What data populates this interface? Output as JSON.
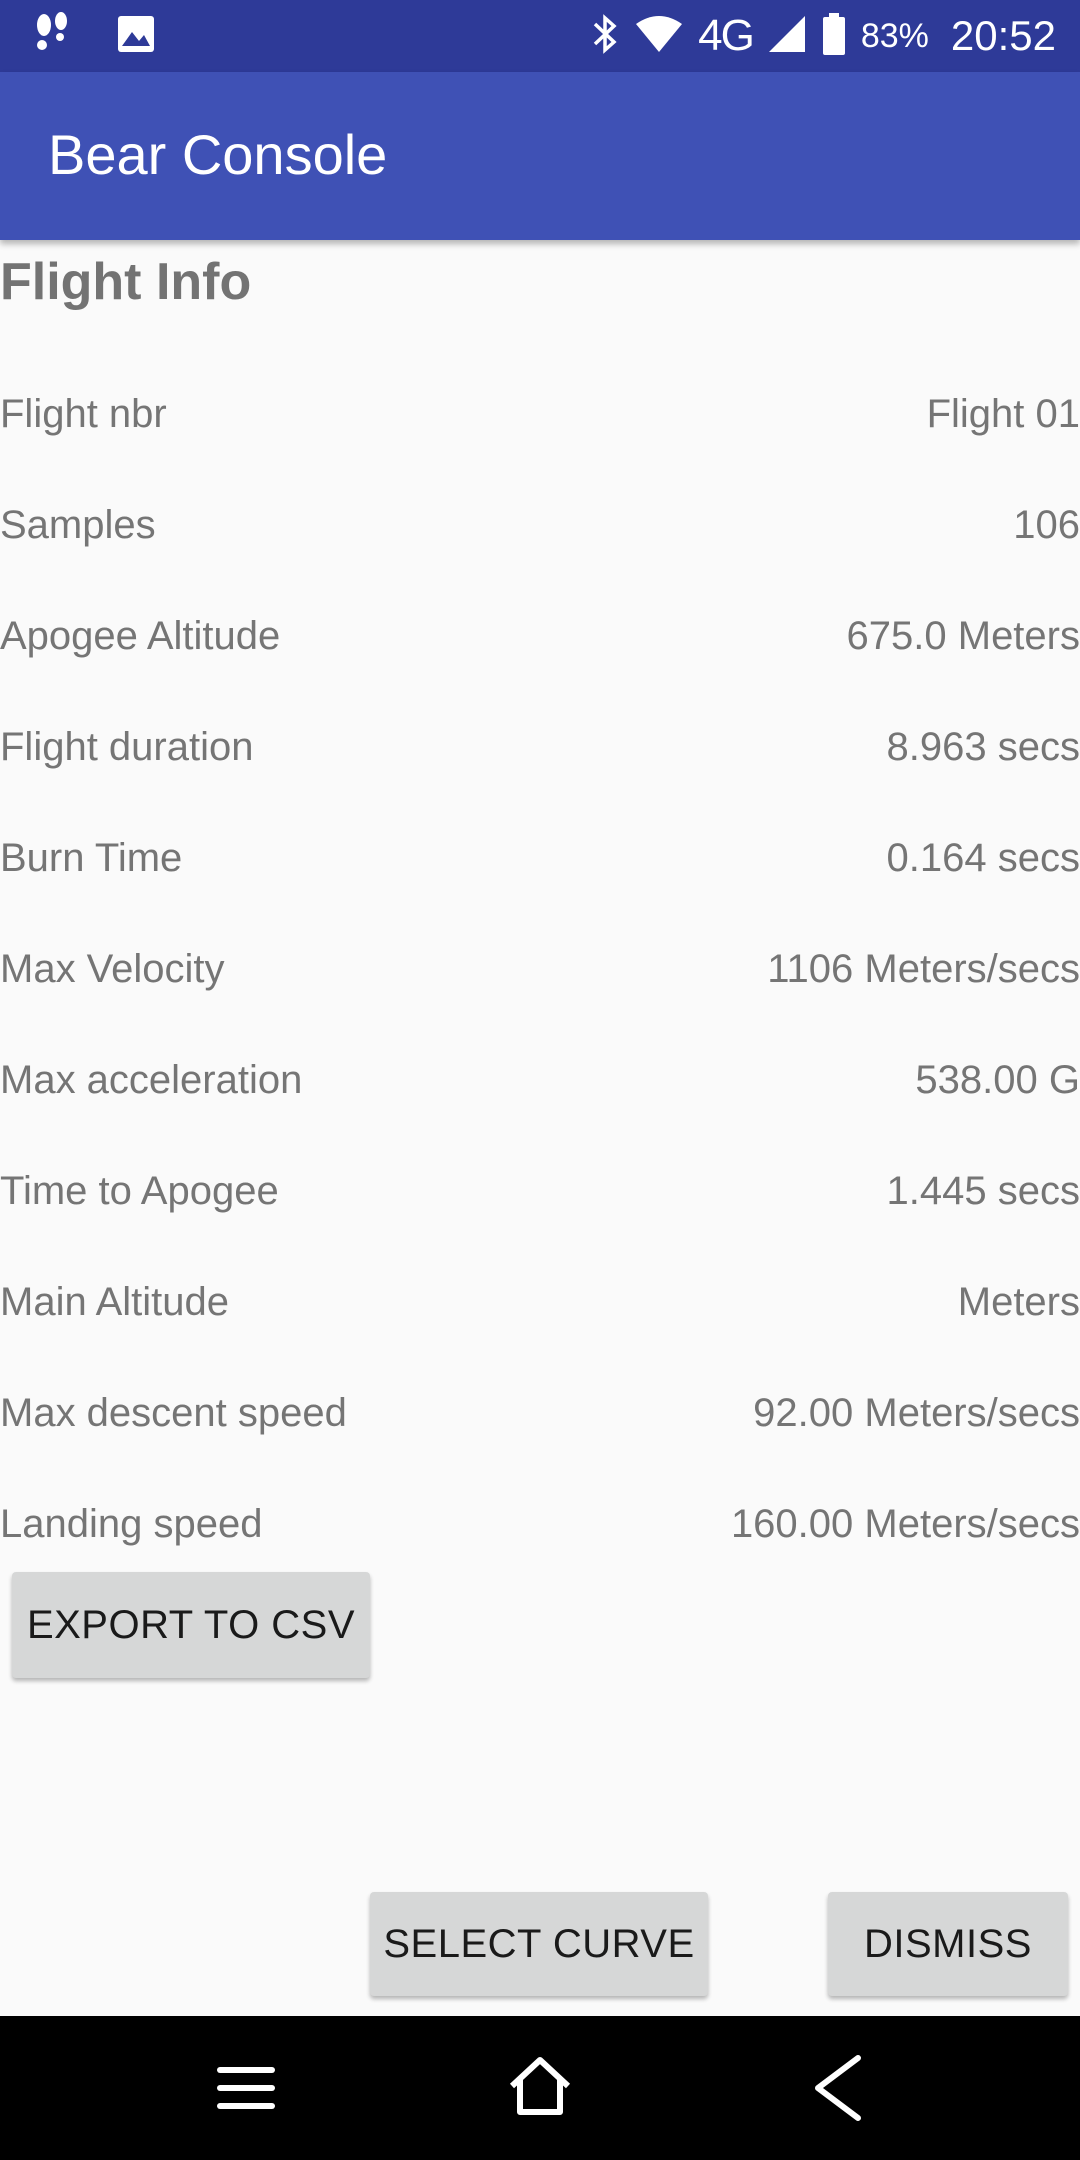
{
  "status_bar": {
    "network": "4G",
    "battery_percent": "83%",
    "time": "20:52"
  },
  "app_bar": {
    "title": "Bear Console"
  },
  "flight_info": {
    "title": "Flight Info",
    "rows": [
      {
        "label": "Flight nbr",
        "value": "Flight 01"
      },
      {
        "label": "Samples",
        "value": "106"
      },
      {
        "label": "Apogee Altitude",
        "value": "675.0 Meters"
      },
      {
        "label": "Flight duration",
        "value": "8.963 secs"
      },
      {
        "label": "Burn Time",
        "value": "0.164 secs"
      },
      {
        "label": "Max Velocity",
        "value": "1106 Meters/secs"
      },
      {
        "label": "Max acceleration",
        "value": "538.00 G"
      },
      {
        "label": "Time to Apogee",
        "value": "1.445 secs"
      },
      {
        "label": "Main Altitude",
        "value": "Meters"
      },
      {
        "label": "Max descent speed",
        "value": "92.00 Meters/secs"
      },
      {
        "label": "Landing speed",
        "value": "160.00 Meters/secs"
      }
    ]
  },
  "buttons": {
    "export": "EXPORT TO CSV",
    "select_curve": "SELECT CURVE",
    "dismiss": "DISMISS"
  },
  "colors": {
    "status_bar": "#2e3a98",
    "app_bar": "#3f51b5",
    "background": "#fafafa",
    "text": "#757575",
    "button": "#d6d7d7"
  }
}
